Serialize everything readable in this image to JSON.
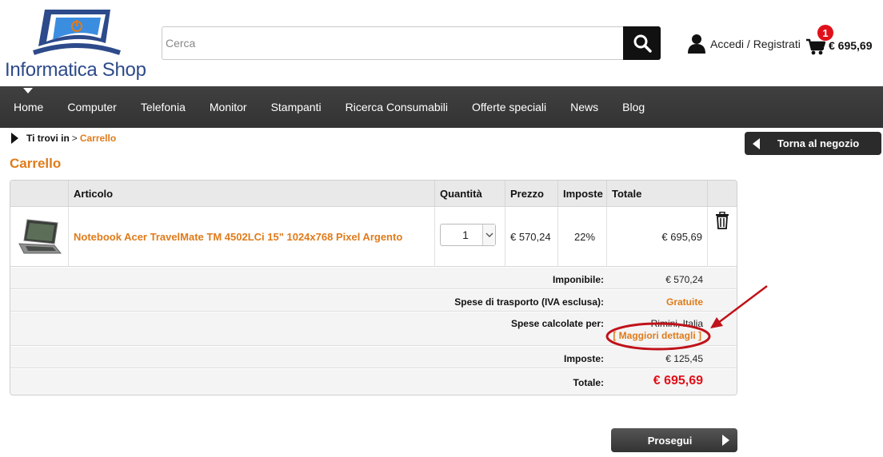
{
  "brand": {
    "name": "Informatica Shop",
    "color": "#2d4a8a",
    "accent": "#e07b1a"
  },
  "search": {
    "placeholder": "Cerca",
    "value": "",
    "icon": "search-icon"
  },
  "account": {
    "label": "Accedi / Registrati",
    "icon": "user-icon"
  },
  "cart": {
    "count": "1",
    "total": "€ 695,69",
    "icon": "cart-icon"
  },
  "nav": {
    "items": [
      "Home",
      "Computer",
      "Telefonia",
      "Monitor",
      "Stampanti",
      "Ricerca Consumabili",
      "Offerte speciali",
      "News",
      "Blog"
    ]
  },
  "breadcrumb": {
    "label": "Ti trovi in",
    "separator": ">",
    "current": "Carrello"
  },
  "page": {
    "title": "Carrello",
    "back_label": "Torna al negozio",
    "proceed_label": "Prosegui"
  },
  "table": {
    "headers": {
      "article": "Articolo",
      "quantity": "Quantità",
      "price": "Prezzo",
      "tax": "Imposte",
      "total": "Totale"
    },
    "rows": [
      {
        "name": "Notebook Acer TravelMate TM 4502LCi 15\" 1024x768 Pixel Argento",
        "quantity": "1",
        "price": "€ 570,24",
        "tax": "22%",
        "total": "€ 695,69",
        "thumbnail": "laptop-thumbnail",
        "delete_icon": "trash-icon"
      }
    ]
  },
  "summary": {
    "taxable_label": "Imponibile:",
    "taxable_value": "€ 570,24",
    "shipping_label": "Spese di trasporto (IVA esclusa):",
    "shipping_value": "Gratuite",
    "calc_label": "Spese calcolate per:",
    "calc_location": "Rimini, Italia",
    "calc_details": "[ Maggiori dettagli ]",
    "taxes_label": "Imposte:",
    "taxes_value": "€ 125,45",
    "total_label": "Totale:",
    "total_value": "€ 695,69",
    "total_color": "#e0101a"
  },
  "annotation": {
    "color": "#c0121a"
  }
}
